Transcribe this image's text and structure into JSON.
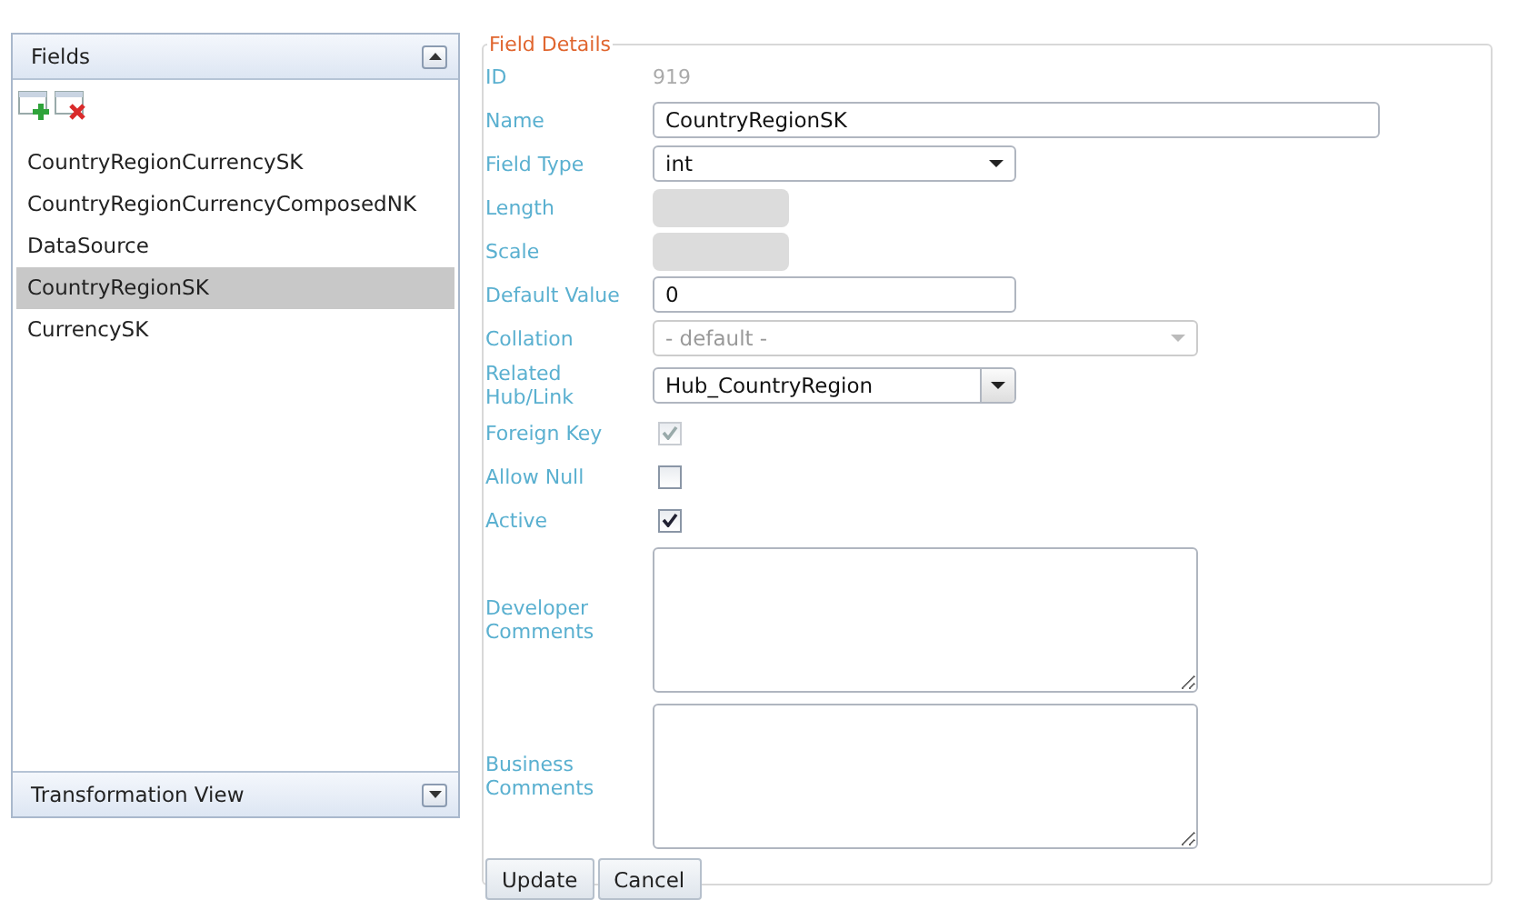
{
  "fields_panel": {
    "title": "Fields",
    "expanded": true,
    "items": [
      {
        "label": "CountryRegionCurrencySK",
        "selected": false
      },
      {
        "label": "CountryRegionCurrencyComposedNK",
        "selected": false
      },
      {
        "label": "DataSource",
        "selected": false
      },
      {
        "label": "CountryRegionSK",
        "selected": true
      },
      {
        "label": "CurrencySK",
        "selected": false
      }
    ]
  },
  "transformation_panel": {
    "title": "Transformation View",
    "expanded": false
  },
  "field_details": {
    "legend": "Field Details",
    "rows": [
      {
        "kind": "static",
        "label": "ID",
        "value": "919"
      },
      {
        "kind": "longtext",
        "label": "Name",
        "value": "CountryRegionSK"
      },
      {
        "kind": "select",
        "label": "Field Type",
        "value": "int",
        "disabled": false
      },
      {
        "kind": "blank",
        "label": "Length"
      },
      {
        "kind": "blank",
        "label": "Scale"
      },
      {
        "kind": "text",
        "label": "Default Value",
        "value": "0"
      },
      {
        "kind": "select",
        "label": "Collation",
        "value": "- default -",
        "disabled": true
      },
      {
        "kind": "combo",
        "label": "Related Hub/Link",
        "value": "Hub_CountryRegion"
      },
      {
        "kind": "checkbox",
        "label": "Foreign Key",
        "checked": true,
        "disabled": true
      },
      {
        "kind": "checkbox",
        "label": "Allow Null",
        "checked": false,
        "disabled": false
      },
      {
        "kind": "checkbox",
        "label": "Active",
        "checked": true,
        "disabled": false
      },
      {
        "kind": "textarea",
        "label": "Developer Comments"
      },
      {
        "kind": "textarea",
        "label": "Business Comments"
      }
    ],
    "buttons": [
      "Update",
      "Cancel"
    ]
  }
}
